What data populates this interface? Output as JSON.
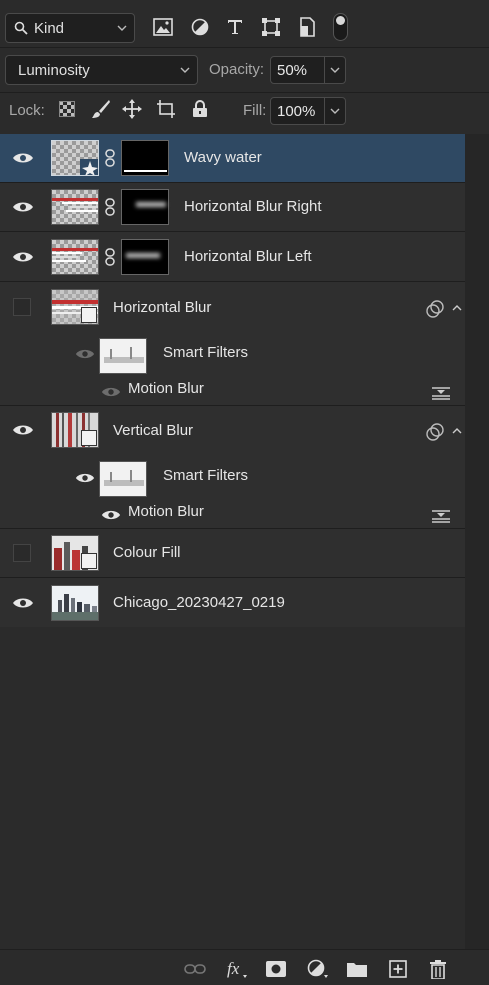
{
  "filter_bar": {
    "kind_label": "Kind"
  },
  "blend": {
    "mode": "Luminosity",
    "opacity_label": "Opacity:",
    "opacity_value": "50%"
  },
  "lock": {
    "lock_label": "Lock:",
    "fill_label": "Fill:",
    "fill_value": "100%"
  },
  "layers": [
    {
      "name": "Wavy water",
      "visible": true,
      "selected": true,
      "has_mask": true
    },
    {
      "name": "Horizontal Blur Right",
      "visible": true,
      "has_mask": true
    },
    {
      "name": "Horizontal Blur Left",
      "visible": true,
      "has_mask": true
    },
    {
      "name": "Horizontal Blur",
      "visible": false,
      "smart_object": true,
      "smart_filters_label": "Smart Filters",
      "filter_name": "Motion Blur"
    },
    {
      "name": "Vertical Blur",
      "visible": true,
      "smart_object": true,
      "smart_filters_label": "Smart Filters",
      "filter_name": "Motion Blur"
    },
    {
      "name": "Colour Fill",
      "visible": false,
      "smart_object": true
    },
    {
      "name": "Chicago_20230427_0219",
      "visible": true
    }
  ],
  "colors": {
    "panel_bg": "#2b2b2b",
    "row_bg": "#2f2f2f",
    "selected_bg": "#2f4963"
  },
  "bottom_toolbar": [
    "link-layers-icon",
    "fx-icon",
    "add-mask-icon",
    "adjustment-layer-icon",
    "new-group-icon",
    "new-layer-icon",
    "delete-icon"
  ]
}
